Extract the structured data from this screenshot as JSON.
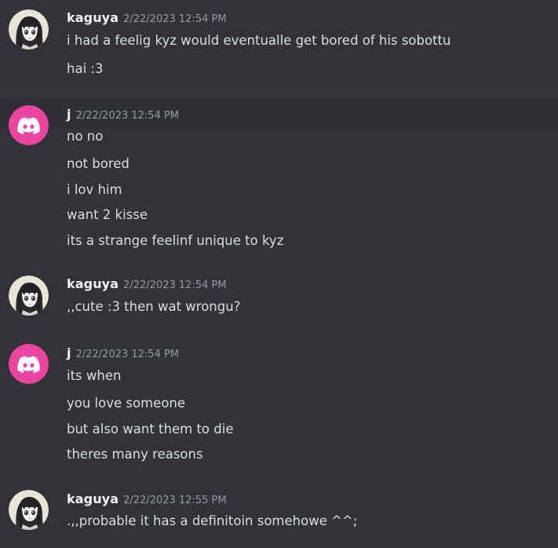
{
  "groups": [
    {
      "author": "kaguya",
      "timestamp": "2/22/2023 12:54 PM",
      "avatar_icon": "anime-girl-avatar-icon",
      "messages": [
        "i had a feelig kyz would eventualle get bored of his sobottu",
        "hai :3"
      ]
    },
    {
      "author": "j",
      "timestamp": "2/22/2023 12:54 PM",
      "avatar_icon": "discord-default-avatar-icon",
      "messages": [
        "no no",
        "not bored",
        "i lov him",
        "want 2 kisse",
        "its a strange feelinf unique to kyz"
      ]
    },
    {
      "author": "kaguya",
      "timestamp": "2/22/2023 12:54 PM",
      "avatar_icon": "anime-girl-avatar-icon",
      "messages": [
        ",,cute :3 then wat wrongu?"
      ]
    },
    {
      "author": "j",
      "timestamp": "2/22/2023 12:54 PM",
      "avatar_icon": "discord-default-avatar-icon",
      "messages": [
        "its when",
        "you love someone",
        "but also want them to die",
        "theres many reasons"
      ]
    },
    {
      "author": "kaguya",
      "timestamp": "2/22/2023 12:55 PM",
      "avatar_icon": "anime-girl-avatar-icon",
      "messages": [
        ".,,probable it has a definitoin somehowe ^^;"
      ]
    }
  ],
  "colors": {
    "background": "#313338",
    "highlight": "#2e3035",
    "username": "#f2f3f5",
    "timestamp": "#949ba4",
    "message_text": "#dbdee1",
    "discord_avatar_bg": "#eb459f"
  }
}
